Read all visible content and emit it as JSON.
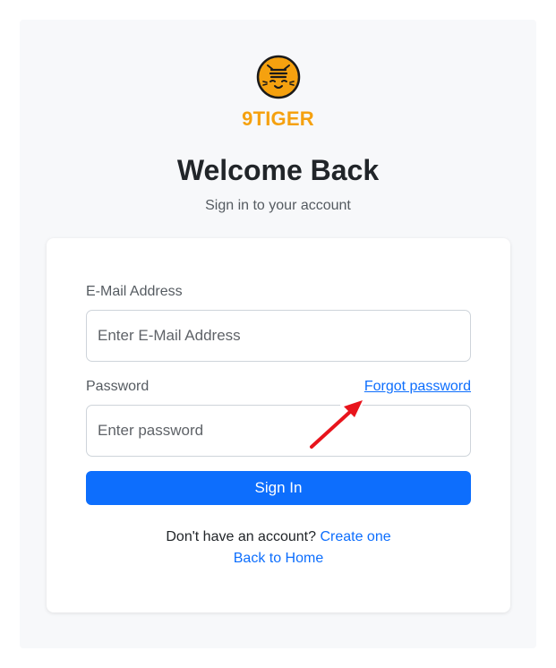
{
  "brand": {
    "name": "9TIGER",
    "accent_color": "#f5a10f",
    "logo_icon": "tiger-face-icon"
  },
  "header": {
    "title": "Welcome Back",
    "subtitle": "Sign in to your account"
  },
  "form": {
    "email_label": "E-Mail Address",
    "email_placeholder": "Enter E-Mail Address",
    "email_value": "",
    "password_label": "Password",
    "password_placeholder": "Enter password",
    "password_value": "",
    "forgot_link": "Forgot password",
    "submit_label": "Sign In",
    "primary_color": "#0d6efd"
  },
  "footer": {
    "no_account_text": "Don't have an account?",
    "create_link": "Create one",
    "back_link": "Back to Home"
  },
  "annotation": {
    "arrow_icon": "red-arrow-icon",
    "arrow_color": "#e8141c"
  }
}
